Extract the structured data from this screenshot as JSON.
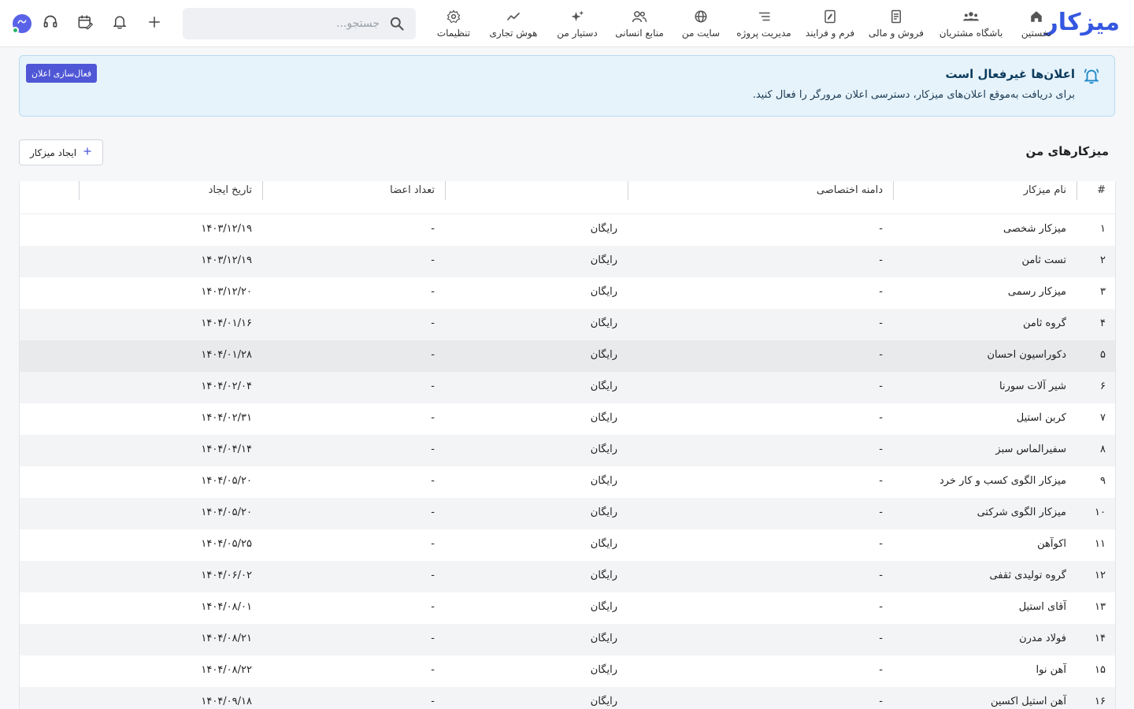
{
  "app": {
    "logo_text": "میزکار",
    "accent": "#3557e0"
  },
  "nav": [
    {
      "label": "نخستین",
      "icon": "home-icon"
    },
    {
      "label": "باشگاه مشتریان",
      "icon": "group-icon"
    },
    {
      "label": "فروش و مالی",
      "icon": "receipt-icon"
    },
    {
      "label": "فرم و فرایند",
      "icon": "form-icon"
    },
    {
      "label": "مدیریت پروژه",
      "icon": "list-icon"
    },
    {
      "label": "سایت من",
      "icon": "globe-icon"
    },
    {
      "label": "منابع انسانی",
      "icon": "people-icon"
    },
    {
      "label": "دستیار من",
      "icon": "sparkle-icon"
    },
    {
      "label": "هوش تجاری",
      "icon": "chart-line-icon"
    },
    {
      "label": "تنظیمات",
      "icon": "gear-icon"
    }
  ],
  "search": {
    "placeholder": "جستجو...",
    "value": ""
  },
  "banner": {
    "title": "اعلان‌ها غیرفعال است",
    "text": "برای دریافت به‌موقع اعلان‌های میزکار، دسترسی اعلان مرورگر را فعال کنید.",
    "button": "فعال‌سازی اعلان"
  },
  "section": {
    "title": "میزکارهای من",
    "create_button": "ایجاد میزکار"
  },
  "table": {
    "headers": {
      "index": "#",
      "name": "نام میزکار",
      "domain": "دامنه اختصاصی",
      "plan": "",
      "members": "تعداد اعضا",
      "created": "تاریخ ایجاد"
    },
    "rows": [
      {
        "index": "۱",
        "name": "میزکار شخصی",
        "domain": "-",
        "plan": "رایگان",
        "members": "-",
        "created": "۱۴۰۳/۱۲/۱۹"
      },
      {
        "index": "۲",
        "name": "تست ثامن",
        "domain": "-",
        "plan": "رایگان",
        "members": "-",
        "created": "۱۴۰۳/۱۲/۱۹"
      },
      {
        "index": "۳",
        "name": "میزکار رسمی",
        "domain": "-",
        "plan": "رایگان",
        "members": "-",
        "created": "۱۴۰۳/۱۲/۲۰"
      },
      {
        "index": "۴",
        "name": "گروه ثامن",
        "domain": "-",
        "plan": "رایگان",
        "members": "-",
        "created": "۱۴۰۴/۰۱/۱۶"
      },
      {
        "index": "۵",
        "name": "دکوراسیون احسان",
        "domain": "-",
        "plan": "رایگان",
        "members": "-",
        "created": "۱۴۰۴/۰۱/۲۸"
      },
      {
        "index": "۶",
        "name": "شیر آلات سورنا",
        "domain": "-",
        "plan": "رایگان",
        "members": "-",
        "created": "۱۴۰۴/۰۲/۰۴"
      },
      {
        "index": "۷",
        "name": "کربن استیل",
        "domain": "-",
        "plan": "رایگان",
        "members": "-",
        "created": "۱۴۰۴/۰۲/۳۱"
      },
      {
        "index": "۸",
        "name": "سفیرالماس سبز",
        "domain": "-",
        "plan": "رایگان",
        "members": "-",
        "created": "۱۴۰۴/۰۴/۱۴"
      },
      {
        "index": "۹",
        "name": "میزکار الگوی کسب و کار خرد",
        "domain": "-",
        "plan": "رایگان",
        "members": "-",
        "created": "۱۴۰۴/۰۵/۲۰"
      },
      {
        "index": "۱۰",
        "name": "میزکار الگوی شرکتی",
        "domain": "-",
        "plan": "رایگان",
        "members": "-",
        "created": "۱۴۰۴/۰۵/۲۰"
      },
      {
        "index": "۱۱",
        "name": "اکوآهن",
        "domain": "-",
        "plan": "رایگان",
        "members": "-",
        "created": "۱۴۰۴/۰۵/۲۵"
      },
      {
        "index": "۱۲",
        "name": "گروه تولیدی ثقفی",
        "domain": "-",
        "plan": "رایگان",
        "members": "-",
        "created": "۱۴۰۴/۰۶/۰۲"
      },
      {
        "index": "۱۳",
        "name": "آقای استیل",
        "domain": "-",
        "plan": "رایگان",
        "members": "-",
        "created": "۱۴۰۴/۰۸/۰۱"
      },
      {
        "index": "۱۴",
        "name": "فولاد مدرن",
        "domain": "-",
        "plan": "رایگان",
        "members": "-",
        "created": "۱۴۰۴/۰۸/۲۱"
      },
      {
        "index": "۱۵",
        "name": "آهن نوا",
        "domain": "-",
        "plan": "رایگان",
        "members": "-",
        "created": "۱۴۰۴/۰۸/۲۲"
      },
      {
        "index": "۱۶",
        "name": "آهن استیل اکسین",
        "domain": "-",
        "plan": "رایگان",
        "members": "-",
        "created": "۱۴۰۴/۰۹/۱۸"
      }
    ]
  }
}
